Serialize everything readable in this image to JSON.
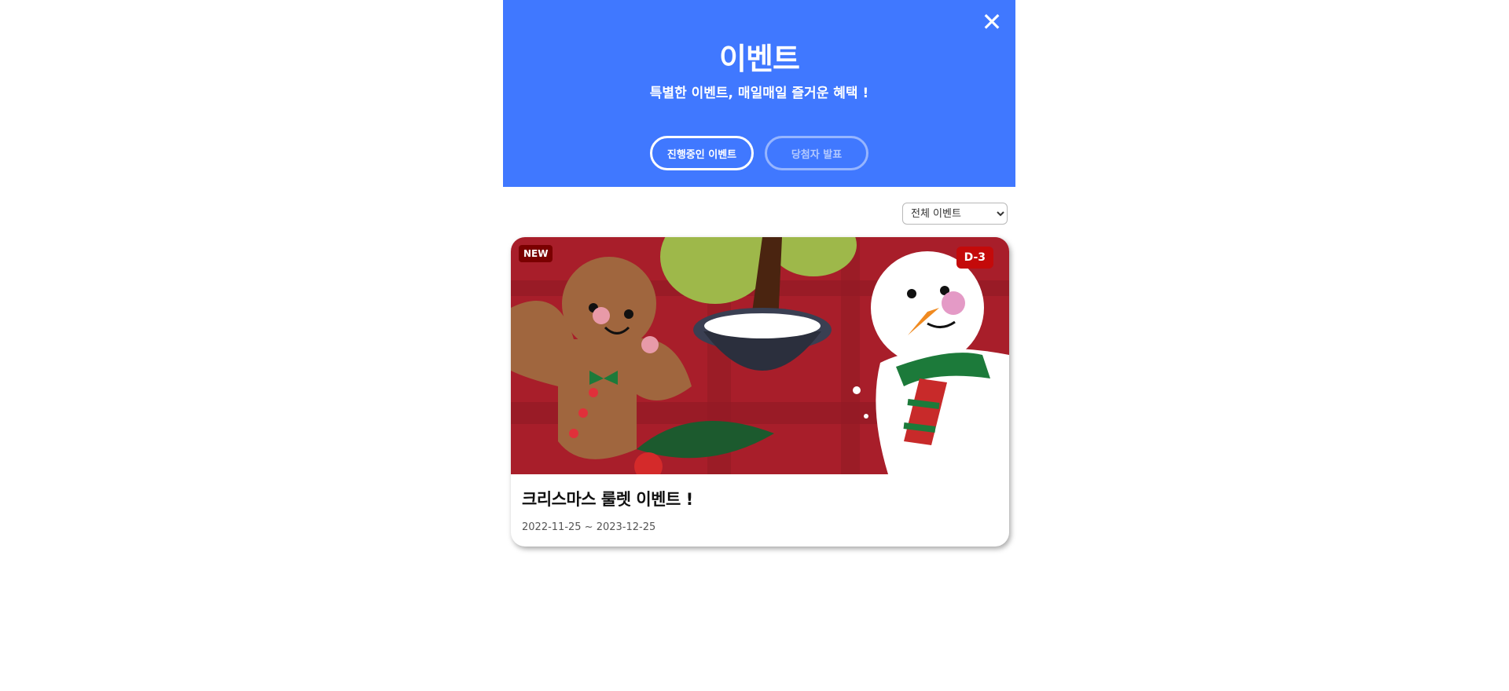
{
  "header": {
    "title": "이벤트",
    "subtitle": "특별한 이벤트, 매일매일 즐거운 혜택 !",
    "close_label": "✕"
  },
  "tabs": [
    {
      "label": "진행중인 이벤트",
      "active": true
    },
    {
      "label": "당첨자 발표",
      "active": false
    }
  ],
  "filter": {
    "selected": "전체 이벤트",
    "options": [
      "전체 이벤트"
    ]
  },
  "events": [
    {
      "badge": "NEW",
      "dday": "D-3",
      "title": "크리스마스 룰렛 이벤트 !",
      "date_range": "2022-11-25 ~ 2023-12-25"
    }
  ],
  "colors": {
    "hero_bg": "#4078ff",
    "badge_new": "#7a0000",
    "badge_dday": "#c40a0a",
    "card_bg": "#a81e2a"
  }
}
